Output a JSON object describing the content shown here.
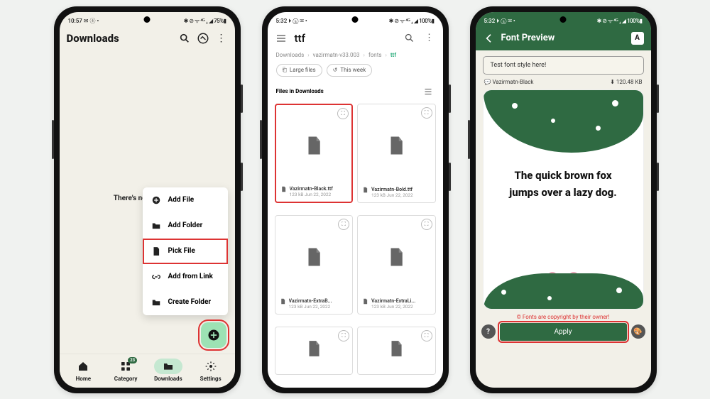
{
  "phone1": {
    "status": {
      "time": "10:57",
      "left_icons": "✉ ⓢ •",
      "right": "✱ ⊘ ᯤ ⁴ᴳ ₊ ◢ 75%▮"
    },
    "header": {
      "title": "Downloads"
    },
    "empty_text": "There's nothing here.",
    "menu": {
      "add_file": "Add File",
      "add_folder": "Add Folder",
      "pick_file": "Pick File",
      "add_link": "Add from Link",
      "create_folder": "Create Folder"
    },
    "nav": {
      "home": "Home",
      "category": "Category",
      "downloads": "Downloads",
      "settings": "Settings",
      "badge": "23"
    }
  },
  "phone2": {
    "status": {
      "time": "5:32",
      "left_icons": "⏵ ⓢ ✉ •",
      "right": "✱ ⊘ ᯤ ⁴ᴳ ₊ ◢ 100%▮"
    },
    "title": "ttf",
    "breadcrumbs": [
      "Downloads",
      "vazirmatn-v33.003",
      "fonts",
      "ttf"
    ],
    "chips": {
      "large": "Large files",
      "week": "This week"
    },
    "section": "Files in Downloads",
    "files": [
      {
        "name": "Vazirmatn-Black.ttf",
        "meta": "123 kB  Jun 22, 2022",
        "hl": true
      },
      {
        "name": "Vazirmatn-Bold.ttf",
        "meta": "123 kB  Jun 22, 2022"
      },
      {
        "name": "Vazirmatn-ExtraB...",
        "meta": "123 kB  Jun 22, 2022"
      },
      {
        "name": "Vazirmatn-ExtraLi...",
        "meta": "123 kB  Jun 22, 2022"
      },
      {
        "name": "",
        "meta": ""
      },
      {
        "name": "",
        "meta": ""
      }
    ]
  },
  "phone3": {
    "status": {
      "time": "5:32",
      "left_icons": "⏵ ⓢ ✉ •",
      "right": "✱ ⊘ ᯤ ⁴ᴳ ₊ ◢ 100%▮"
    },
    "header": {
      "title": "Font Preview"
    },
    "test_placeholder": "Test font style here!",
    "font_name": "Vazirmatn-Black",
    "font_size": "120.48 KB",
    "pangram": "The quick brown fox jumps over a lazy dog.",
    "copyright": "© Fonts are copyright by their owner!",
    "apply": "Apply"
  }
}
